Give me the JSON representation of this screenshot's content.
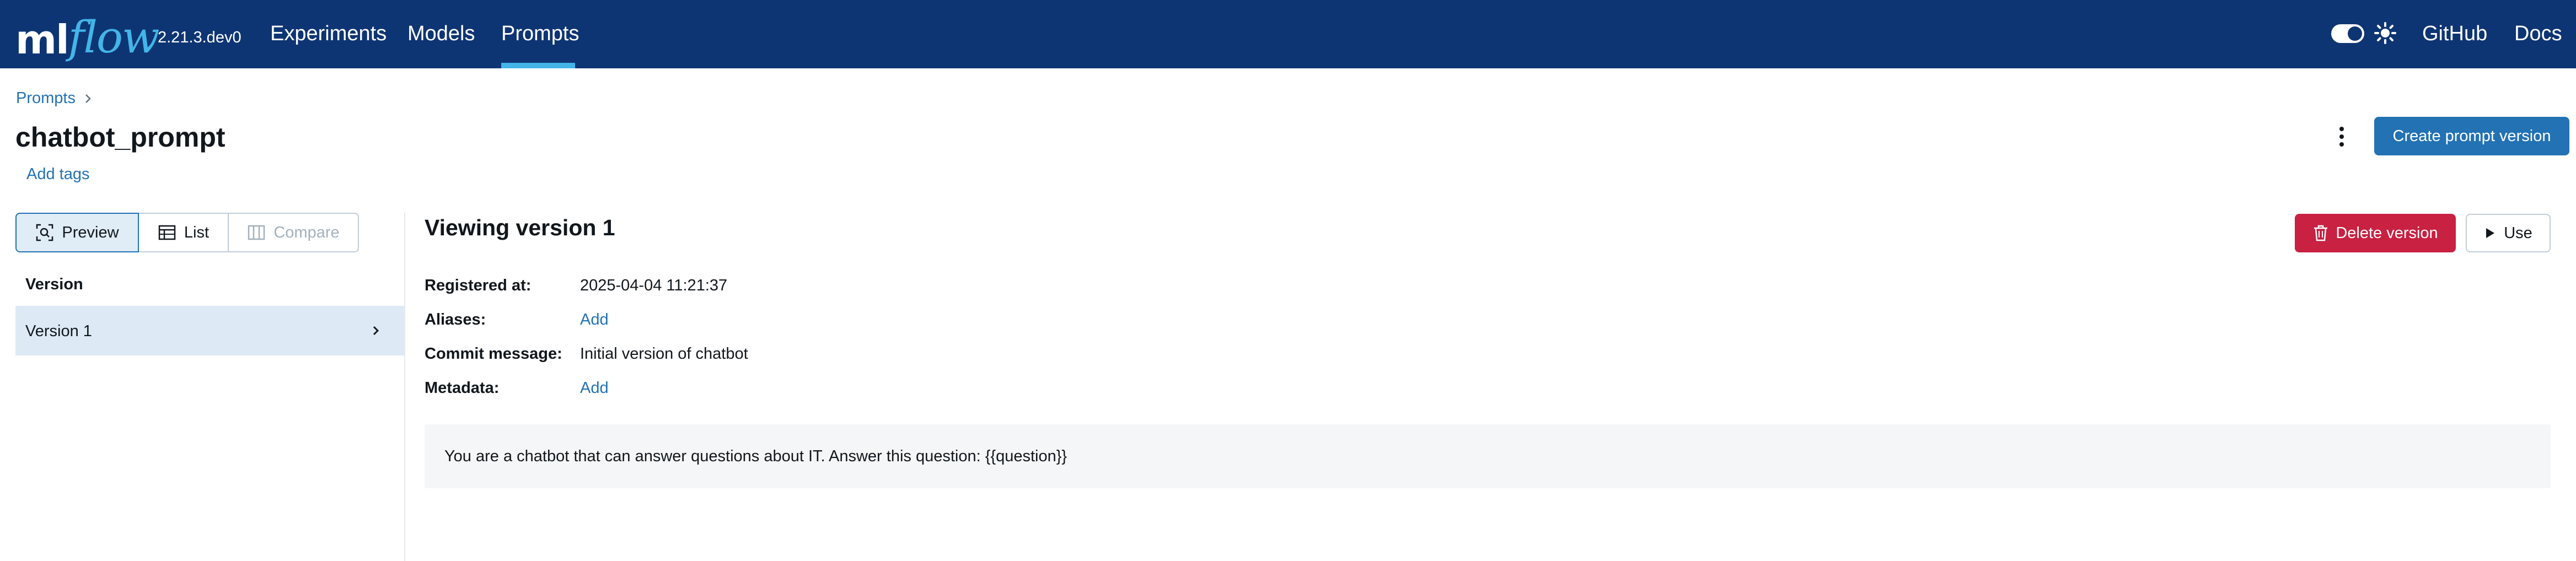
{
  "app": {
    "logo_ml": "ml",
    "logo_flow": "flow",
    "version": "2.21.3.dev0"
  },
  "nav": {
    "items": [
      {
        "label": "Experiments"
      },
      {
        "label": "Models"
      },
      {
        "label": "Prompts",
        "active": true
      }
    ],
    "github": "GitHub",
    "docs": "Docs",
    "theme_toggle_state": "on"
  },
  "breadcrumb": {
    "items": [
      {
        "label": "Prompts"
      }
    ]
  },
  "page": {
    "title": "chatbot_prompt",
    "add_tags": "Add tags",
    "create_button": "Create prompt version"
  },
  "view_modes": {
    "preview": "Preview",
    "list": "List",
    "compare": "Compare",
    "selected": "Preview"
  },
  "versions": {
    "header": "Version",
    "items": [
      {
        "label": "Version 1",
        "selected": true
      }
    ]
  },
  "detail": {
    "title": "Viewing version 1",
    "delete_button": "Delete version",
    "use_button": "Use",
    "registered_label": "Registered at:",
    "registered_value": "2025-04-04 11:21:37",
    "aliases_label": "Aliases:",
    "aliases_action": "Add",
    "commit_label": "Commit message:",
    "commit_value": "Initial version of chatbot",
    "metadata_label": "Metadata:",
    "metadata_action": "Add",
    "prompt_text": "You are a chatbot that can answer questions about IT. Answer this question: {{question}}"
  },
  "colors": {
    "topbar": "#0e3573",
    "accent": "#2272b4",
    "active_tab_indicator": "#43b5e8",
    "danger": "#c82142",
    "selected_row": "#dde9f4"
  },
  "icons": {
    "theme": "sun-icon",
    "kebab": "kebab-menu-icon",
    "preview": "preview-icon",
    "list": "table-icon",
    "compare": "columns-icon",
    "chevron": "chevron-right-icon",
    "delete": "trash-icon",
    "use": "play-icon"
  }
}
